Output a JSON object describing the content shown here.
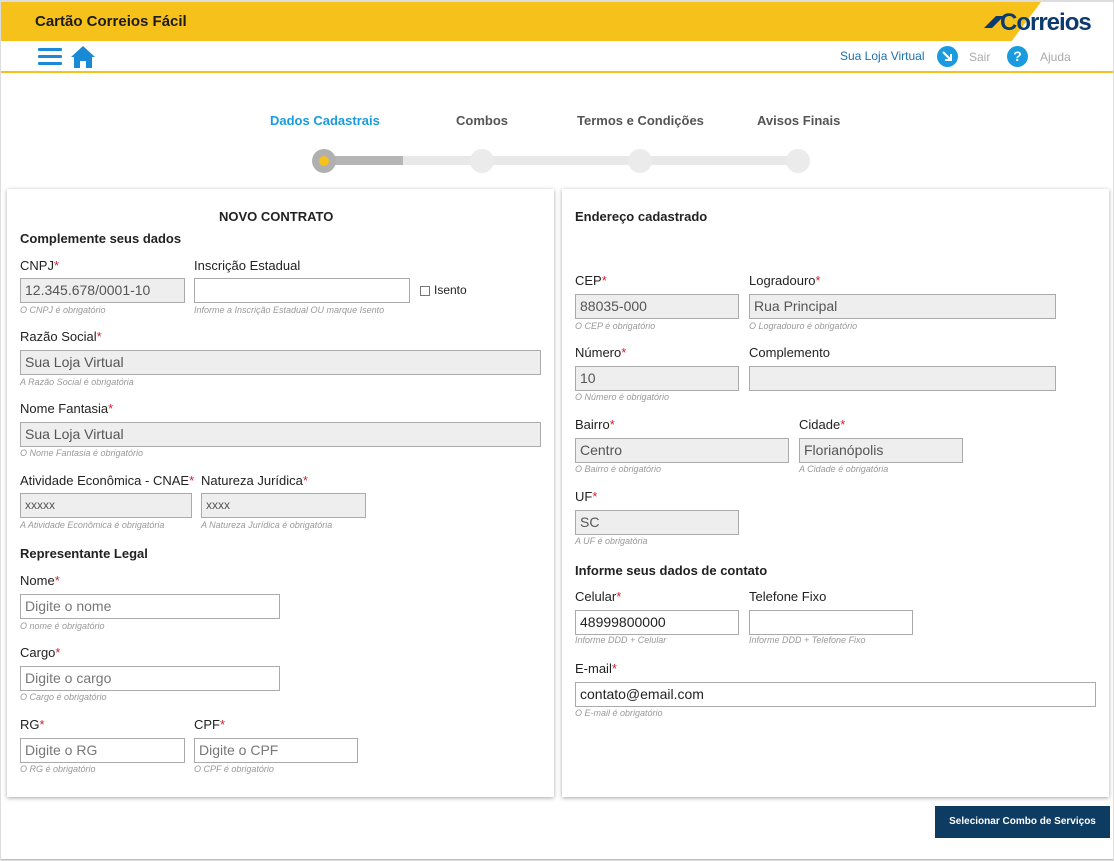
{
  "header": {
    "app_title": "Cartão Correios Fácil",
    "logo_text": "Correios",
    "store_name": "Sua Loja Virtual",
    "logout_label": "Sair",
    "help_label": "Ajuda",
    "help_glyph": "?"
  },
  "steps": [
    {
      "label": "Dados Cadastrais",
      "active": true
    },
    {
      "label": "Combos",
      "active": false
    },
    {
      "label": "Termos e Condições",
      "active": false
    },
    {
      "label": "Avisos Finais",
      "active": false
    }
  ],
  "left": {
    "title": "NOVO CONTRATO",
    "section1": "Complemente seus dados",
    "cnpj": {
      "label": "CNPJ",
      "value": "12.345.678/0001-10",
      "hint": "O CNPJ é obrigatório"
    },
    "ie": {
      "label": "Inscrição Estadual",
      "value": "",
      "hint": "Informe a Inscrição Estadual OU marque Isento"
    },
    "isento_label": "Isento",
    "razao": {
      "label": "Razão Social",
      "value": "Sua Loja Virtual",
      "hint": "A Razão Social é obrigatória"
    },
    "fantasia": {
      "label": "Nome Fantasia",
      "value": "Sua Loja Virtual",
      "hint": "O Nome Fantasia é obrigatório"
    },
    "cnae": {
      "label": "Atividade Econômica - CNAE",
      "value": "xxxxx",
      "hint": "A Atividade Econômica é obrigatória"
    },
    "natureza": {
      "label": "Natureza Jurídica",
      "value": "xxxx",
      "hint": "A Natureza Jurídica é obrigatória"
    },
    "section2": "Representante Legal",
    "nome": {
      "label": "Nome",
      "placeholder": "Digite o nome",
      "hint": "O nome é obrigatório"
    },
    "cargo": {
      "label": "Cargo",
      "placeholder": "Digite o cargo",
      "hint": "O Cargo é obrigatório"
    },
    "rg": {
      "label": "RG",
      "placeholder": "Digite o RG",
      "hint": "O RG é obrigatório"
    },
    "cpf": {
      "label": "CPF",
      "placeholder": "Digite o CPF",
      "hint": "O CPF é obrigatório"
    }
  },
  "right": {
    "title": "Endereço cadastrado",
    "cep": {
      "label": "CEP",
      "value": "88035-000",
      "hint": "O CEP é obrigatório"
    },
    "logradouro": {
      "label": "Logradouro",
      "value": "Rua Principal",
      "hint": "O Logradouro é obrigatório"
    },
    "numero": {
      "label": "Número",
      "value": "10",
      "hint": "O Número é obrigatório"
    },
    "complemento": {
      "label": "Complemento",
      "value": ""
    },
    "bairro": {
      "label": "Bairro",
      "value": "Centro",
      "hint": "O Bairro é obrigatório"
    },
    "cidade": {
      "label": "Cidade",
      "value": "Florianópolis",
      "hint": "A Cidade é obrigatória"
    },
    "uf": {
      "label": "UF",
      "value": "SC",
      "hint": "A UF é obrigatória"
    },
    "section2": "Informe seus dados de contato",
    "celular": {
      "label": "Celular",
      "value": "48999800000",
      "hint": "Informe DDD + Celular"
    },
    "fixo": {
      "label": "Telefone Fixo",
      "value": "",
      "hint": "Informe DDD + Telefone Fixo"
    },
    "email": {
      "label": "E-mail",
      "value": "contato@email.com",
      "hint": "O E-mail é obrigatório"
    }
  },
  "required_mark": "*",
  "next_button": "Selecionar Combo de Serviços",
  "colors": {
    "brand_yellow": "#f7c11c",
    "accent_blue": "#1a9be0",
    "button_navy": "#0e3b62"
  }
}
